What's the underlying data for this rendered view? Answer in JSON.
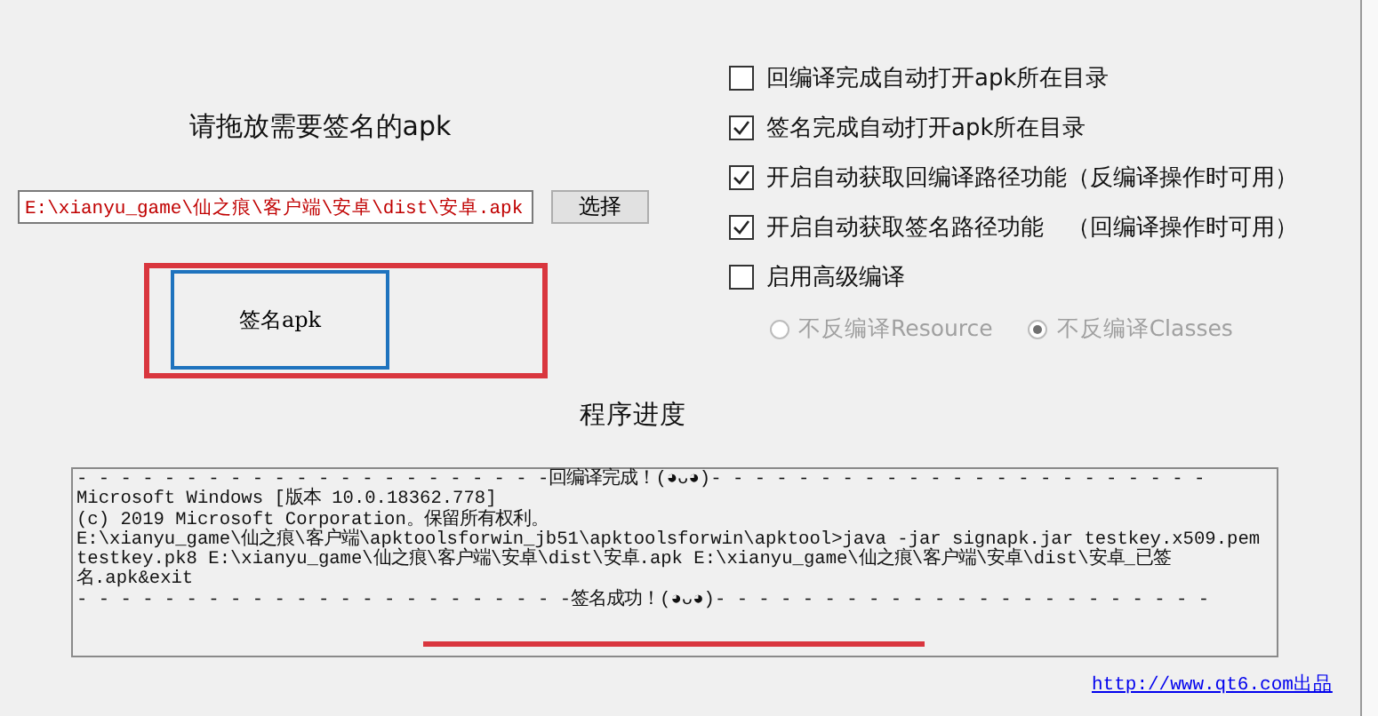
{
  "drop_prompt": "请拖放需要签名的apk",
  "path_field": {
    "value": "E:\\xianyu_game\\仙之痕\\客户端\\安卓\\dist\\安卓.apk"
  },
  "choose_button": "选择",
  "sign_button": "签名apk",
  "options": [
    {
      "label": "回编译完成自动打开apk所在目录",
      "checked": false
    },
    {
      "label": "签名完成自动打开apk所在目录",
      "checked": true
    },
    {
      "label": "开启自动获取回编译路径功能（反编译操作时可用）",
      "checked": true
    },
    {
      "label": "开启自动获取签名路径功能　（回编译操作时可用）",
      "checked": true
    },
    {
      "label": "启用高级编译",
      "checked": false
    }
  ],
  "compile_modes": {
    "disabled": true,
    "items": [
      {
        "label": "不反编译Resource",
        "selected": false
      },
      {
        "label": "不反编译Classes",
        "selected": true
      }
    ]
  },
  "progress_title": "程序进度",
  "log_lines": [
    {
      "text": "- - - - - - - - - - - - - - - - - - - - - -回编译完成！(◕ᴗ◕)- - - - - - - - - - - - - - - - - - - - - - -"
    },
    {
      "text": "Microsoft Windows [版本 10.0.18362.778]"
    },
    {
      "text": "(c) 2019 Microsoft Corporation。保留所有权利。"
    },
    {
      "text": "E:\\xianyu_game\\仙之痕\\客户端\\apktoolsforwin_jb51\\apktoolsforwin\\apktool>java -jar signapk.jar testkey.x509.pem"
    },
    {
      "text": "testkey.pk8 E:\\xianyu_game\\仙之痕\\客户端\\安卓\\dist\\安卓.apk E:\\xianyu_game\\仙之痕\\客户端\\安卓\\dist\\安卓_已签"
    },
    {
      "text": "名.apk&exit"
    },
    {
      "text": "- - - - - - - - - - - - - - - - - - - - - - -签名成功！(◕ᴗ◕)- - - - - - - - - - - - - - - - - - - - - - -"
    }
  ],
  "credit_link": "http://www.qt6.com出品"
}
